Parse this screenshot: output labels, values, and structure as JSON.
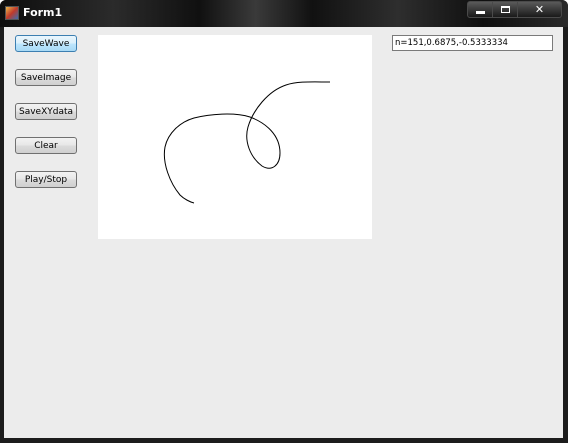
{
  "window": {
    "title": "Form1"
  },
  "buttons": {
    "save_wave": "SaveWave",
    "save_image": "SaveImage",
    "save_xy_data": "SaveXYdata",
    "clear": "Clear",
    "play_stop": "Play/Stop"
  },
  "status_box": {
    "value": "n=151,0.6875,-0.5333334"
  },
  "icons": {
    "app": "app-icon",
    "minimize": "minimize-icon",
    "maximize": "maximize-icon",
    "close": "close-icon"
  },
  "colors": {
    "client_background": "#ececec",
    "canvas_background": "#ffffff",
    "stroke": "#000000",
    "focused_button": "#3c7fb1"
  }
}
